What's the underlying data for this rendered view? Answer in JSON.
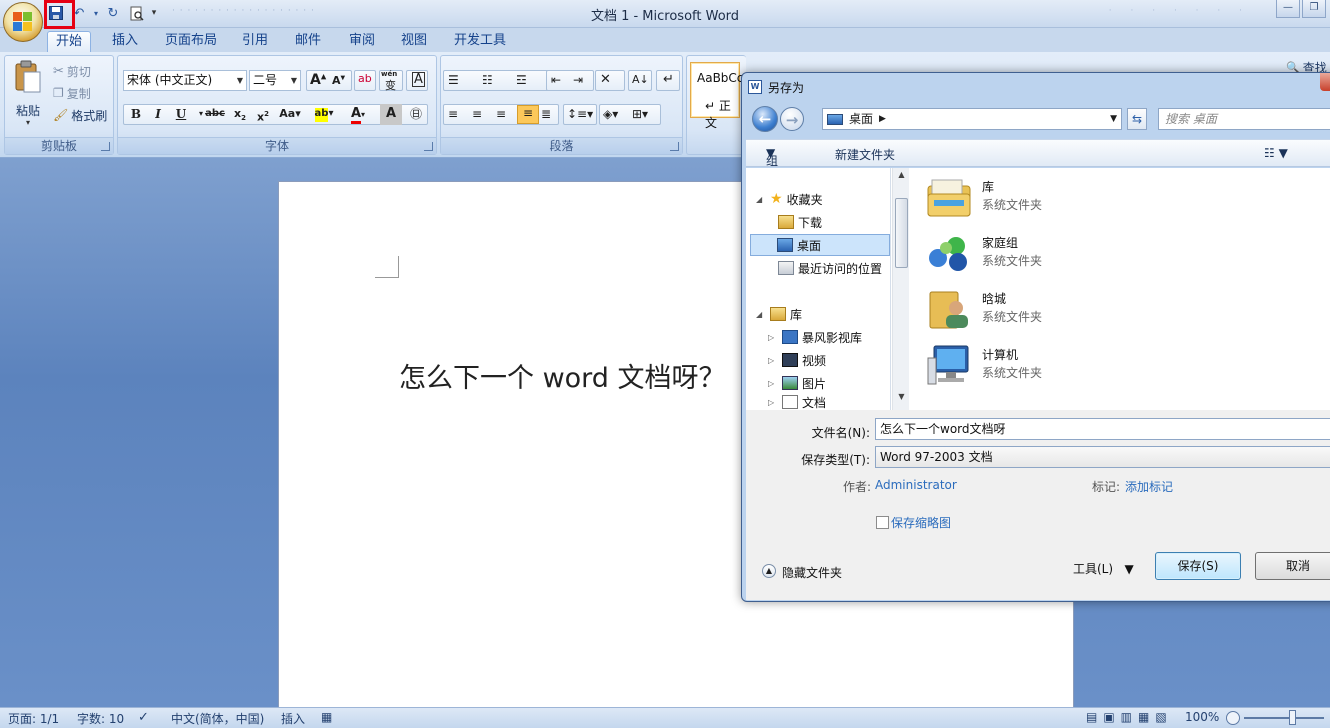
{
  "window": {
    "title": "文档 1 - Microsoft Word"
  },
  "quick_access": {
    "save_icon": "save-icon",
    "undo_icon": "undo-icon",
    "redo_icon": "redo-icon",
    "preview_icon": "print-preview-icon"
  },
  "tabs": [
    {
      "label": "开始",
      "active": true
    },
    {
      "label": "插入"
    },
    {
      "label": "页面布局"
    },
    {
      "label": "引用"
    },
    {
      "label": "邮件"
    },
    {
      "label": "审阅"
    },
    {
      "label": "视图"
    },
    {
      "label": "开发工具"
    }
  ],
  "ribbon": {
    "clipboard": {
      "label": "剪贴板",
      "paste": "粘贴",
      "cut": "剪切",
      "copy": "复制",
      "format_painter": "格式刷"
    },
    "font": {
      "label": "字体",
      "font_name": "宋体 (中文正文)",
      "font_size": "二号",
      "wen": "wén",
      "bian": "变",
      "char_a": "A"
    },
    "paragraph": {
      "label": "段落"
    },
    "styles": {
      "sample": "AaBbCc",
      "name": "正文"
    },
    "editing": {
      "find": "查找"
    }
  },
  "document": {
    "text": "怎么下一个 word 文档呀？"
  },
  "statusbar": {
    "page": "页面: 1/1",
    "words": "字数: 10",
    "language": "中文(简体，中国)",
    "mode": "插入",
    "zoom": "100%"
  },
  "dialog": {
    "title": "另存为",
    "address": "桌面",
    "search_placeholder": "搜索 桌面",
    "toolbar": {
      "organize": "组织",
      "new_folder": "新建文件夹"
    },
    "nav": {
      "favorites": "收藏夹",
      "downloads": "下载",
      "desktop": "桌面",
      "recent": "最近访问的位置",
      "libraries": "库",
      "storm": "暴风影视库",
      "videos": "视频",
      "pictures": "图片",
      "docs": "文档"
    },
    "files": [
      {
        "name": "库",
        "type": "系统文件夹"
      },
      {
        "name": "家庭组",
        "type": "系统文件夹"
      },
      {
        "name": "晗城",
        "type": "系统文件夹"
      },
      {
        "name": "计算机",
        "type": "系统文件夹"
      }
    ],
    "filename_label": "文件名(N):",
    "filename": "怎么下一个word文档呀",
    "filetype_label": "保存类型(T):",
    "filetype": "Word 97-2003 文档",
    "author_label": "作者:",
    "author": "Administrator",
    "tags_label": "标记:",
    "tags": "添加标记",
    "thumbnail": "保存缩略图",
    "hide_folders": "隐藏文件夹",
    "tools": "工具(L)",
    "save": "保存(S)",
    "cancel": "取消"
  }
}
